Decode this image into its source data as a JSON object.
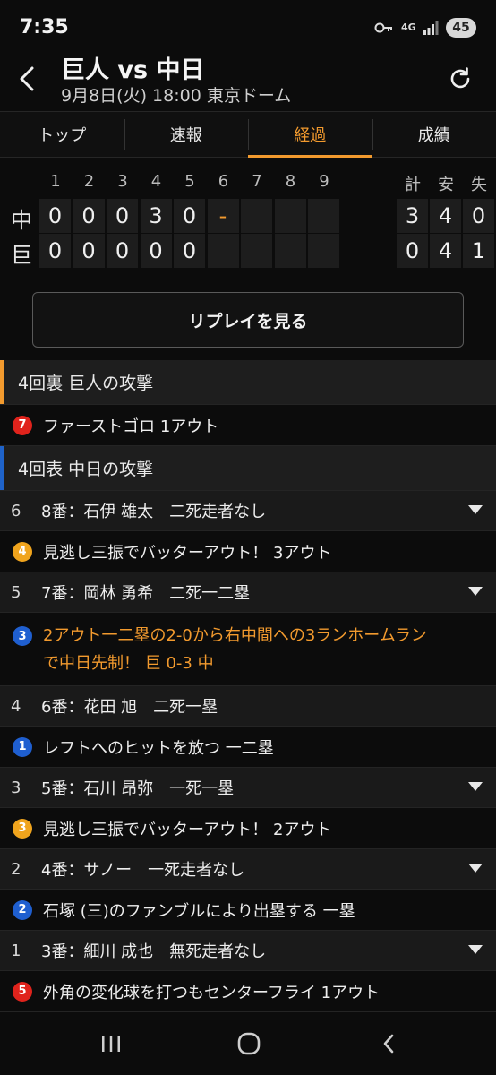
{
  "status": {
    "time": "7:35",
    "network": "4G",
    "battery": "45"
  },
  "header": {
    "title": "巨人 vs 中日",
    "subtitle": "9月8日(火) 18:00 東京ドーム"
  },
  "tabs": [
    {
      "label": "トップ",
      "active": false
    },
    {
      "label": "速報",
      "active": false
    },
    {
      "label": "経過",
      "active": true
    },
    {
      "label": "成績",
      "active": false
    }
  ],
  "scoreboard": {
    "innings": [
      "1",
      "2",
      "3",
      "4",
      "5",
      "6",
      "7",
      "8",
      "9"
    ],
    "totals_headers": [
      "計",
      "安",
      "失"
    ],
    "teams": [
      {
        "name": "中",
        "innings": [
          "0",
          "0",
          "0",
          "3",
          "0",
          "-",
          "",
          "",
          ""
        ],
        "totals": [
          "3",
          "4",
          "0"
        ]
      },
      {
        "name": "巨",
        "innings": [
          "0",
          "0",
          "0",
          "0",
          "0",
          "",
          "",
          "",
          ""
        ],
        "totals": [
          "0",
          "4",
          "1"
        ]
      }
    ]
  },
  "replay_button": "リプレイを見る",
  "plays": [
    {
      "kind": "section",
      "text": "4回裏 巨人の攻撃",
      "color": "#f29a2e"
    },
    {
      "kind": "event",
      "badge": "7",
      "badge_color": "#e0231c",
      "text": "ファーストゴロ 1アウト"
    },
    {
      "kind": "section",
      "text": "4回表 中日の攻撃",
      "color": "#1f63c9"
    },
    {
      "kind": "batter",
      "num": "6",
      "text": "8番：石伊 雄太　二死走者なし",
      "expand": true
    },
    {
      "kind": "event",
      "badge": "4",
      "badge_color": "#f0a41d",
      "text": "見逃し三振でバッターアウト！ 3アウト"
    },
    {
      "kind": "batter",
      "num": "5",
      "text": "7番：岡林 勇希　二死一二塁",
      "expand": true
    },
    {
      "kind": "event-hr",
      "badge": "3",
      "badge_color": "#1f5fd0",
      "text": "2アウト一二塁の2-0から右中間への3ランホームラン",
      "text2": "で中日先制！ 巨 0-3 中"
    },
    {
      "kind": "batter",
      "num": "4",
      "text": "6番：花田 旭　二死一塁",
      "expand": false
    },
    {
      "kind": "event",
      "badge": "1",
      "badge_color": "#1f5fd0",
      "text": "レフトへのヒットを放つ 一二塁"
    },
    {
      "kind": "batter",
      "num": "3",
      "text": "5番：石川 昂弥　一死一塁",
      "expand": true
    },
    {
      "kind": "event",
      "badge": "3",
      "badge_color": "#f0a41d",
      "text": "見逃し三振でバッターアウト！ 2アウト"
    },
    {
      "kind": "batter",
      "num": "2",
      "text": "4番：サノー　一死走者なし",
      "expand": true
    },
    {
      "kind": "event",
      "badge": "2",
      "badge_color": "#1f5fd0",
      "text": "石塚 (三)のファンブルにより出塁する 一塁"
    },
    {
      "kind": "batter",
      "num": "1",
      "text": "3番：細川 成也　無死走者なし",
      "expand": true
    },
    {
      "kind": "event",
      "badge": "5",
      "badge_color": "#e0231c",
      "text": "外角の変化球を打つもセンターフライ 1アウト"
    }
  ],
  "icons": {
    "back": "chevron-left-icon",
    "refresh": "refresh-icon",
    "expand": "triangle-down-icon",
    "nav_recent": "recent-apps-icon",
    "nav_home": "home-icon",
    "nav_back": "back-icon"
  },
  "colors": {
    "accent": "#f29a2e",
    "home_team_bar": "#f29a2e",
    "away_team_bar": "#1f63c9"
  }
}
